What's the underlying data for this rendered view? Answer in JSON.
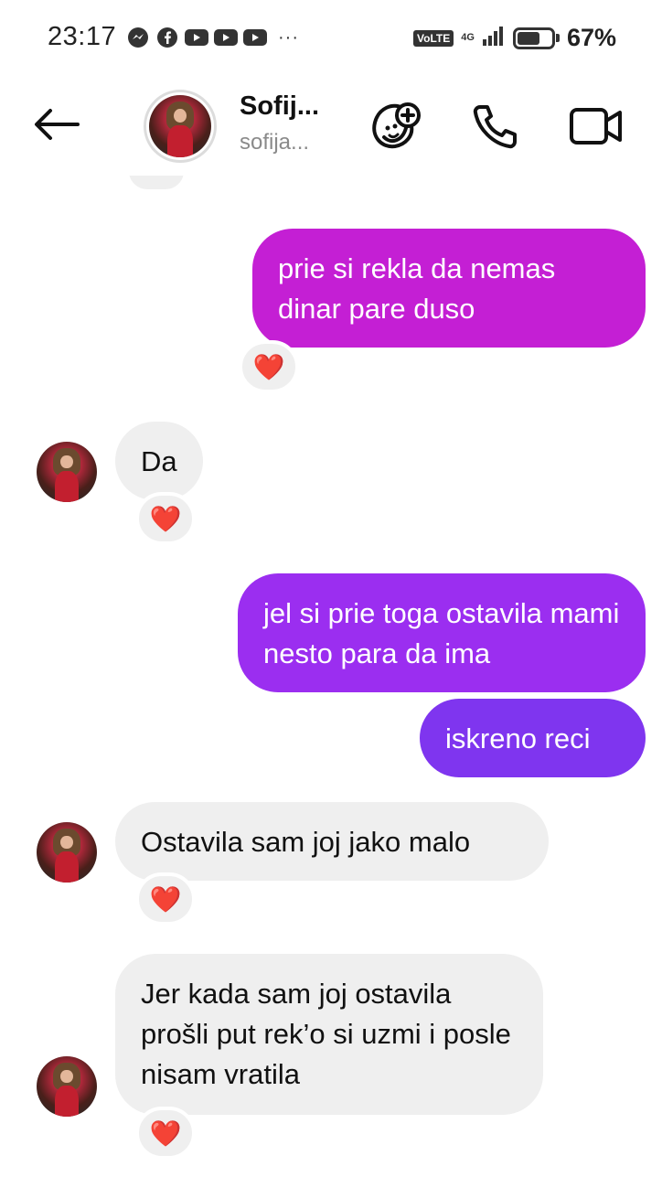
{
  "status_bar": {
    "time": "23:17",
    "app_icons": [
      "messenger-icon",
      "facebook-icon",
      "youtube-icon",
      "youtube-icon",
      "youtube-icon"
    ],
    "more": "···",
    "volte": "VoLTE",
    "network": "4G",
    "battery_percent_text": "67%",
    "battery_level": 0.67
  },
  "header": {
    "contact_name": "Sofij...",
    "contact_username": "sofija..."
  },
  "messages": [
    {
      "direction": "outgoing",
      "text": "prie si rekla  da nemas dinar pare duso",
      "reaction": "❤️"
    },
    {
      "direction": "incoming",
      "text": "Da",
      "reaction": "❤️"
    },
    {
      "direction": "outgoing",
      "text": "jel si prie toga ostavila mami nesto para da ima"
    },
    {
      "direction": "outgoing",
      "text": "iskreno reci"
    },
    {
      "direction": "incoming",
      "text": "Ostavila sam joj jako malo",
      "reaction": "❤️"
    },
    {
      "direction": "incoming",
      "text": "Jer kada sam joj ostavila prošli put rek’o si uzmi i posle nisam vratila",
      "reaction": "❤️"
    }
  ],
  "colors": {
    "outgoing_gradient_top": "#c41fd4",
    "outgoing_gradient_mid": "#9b2ef0",
    "outgoing_gradient_bottom": "#7a38ef",
    "incoming_bubble": "#efefef",
    "heart": "#e8242f"
  }
}
